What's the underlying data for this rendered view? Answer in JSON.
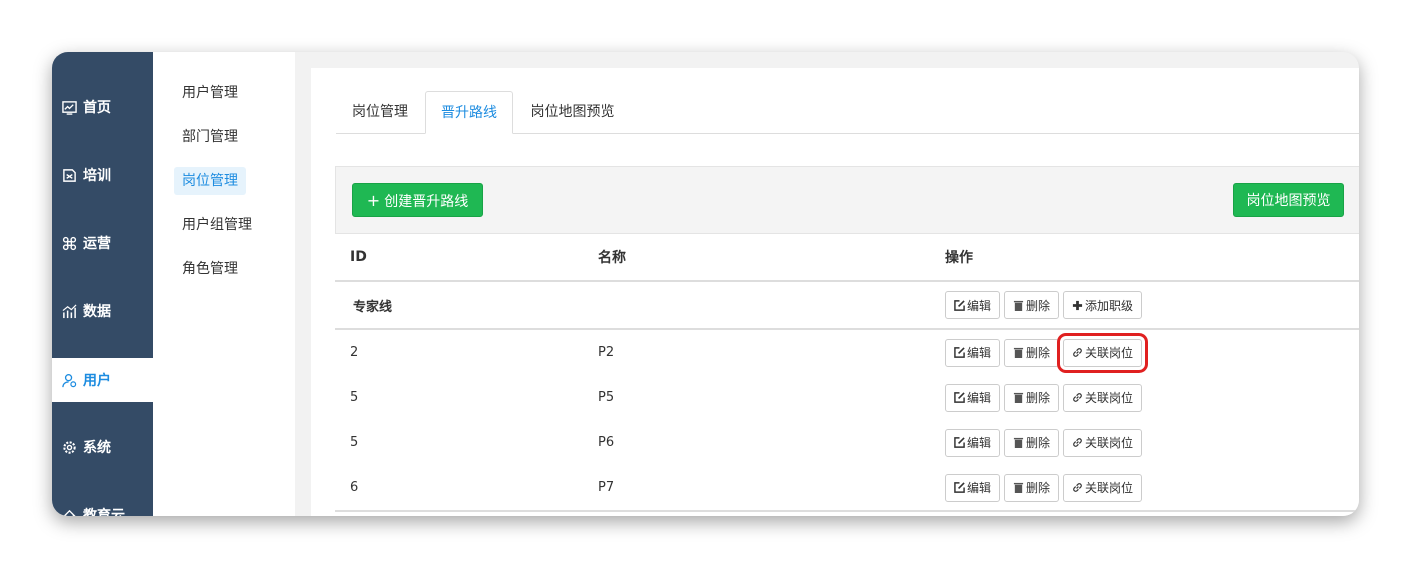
{
  "nav": {
    "items": [
      {
        "label": "首页",
        "icon": "chart-icon"
      },
      {
        "label": "培训",
        "icon": "book-icon"
      },
      {
        "label": "运营",
        "icon": "command-icon"
      },
      {
        "label": "数据",
        "icon": "bar-chart-icon"
      },
      {
        "label": "用户",
        "icon": "user-icon",
        "active": true
      },
      {
        "label": "系统",
        "icon": "gear-icon"
      },
      {
        "label": "教育云",
        "icon": "cloud-icon"
      }
    ]
  },
  "subnav": {
    "items": [
      {
        "label": "用户管理"
      },
      {
        "label": "部门管理"
      },
      {
        "label": "岗位管理",
        "active": true
      },
      {
        "label": "用户组管理"
      },
      {
        "label": "角色管理"
      }
    ]
  },
  "tabs": [
    {
      "label": "岗位管理"
    },
    {
      "label": "晋升路线",
      "active": true
    },
    {
      "label": "岗位地图预览"
    }
  ],
  "toolbar": {
    "create_label": "创建晋升路线",
    "preview_label": "岗位地图预览"
  },
  "table": {
    "headers": {
      "id": "ID",
      "name": "名称",
      "actions": "操作"
    },
    "group": {
      "name": "专家线",
      "edit": "编辑",
      "delete": "删除",
      "add": "添加职级"
    },
    "rows": [
      {
        "id": "2",
        "name": "P2",
        "edit": "编辑",
        "delete": "删除",
        "link": "关联岗位"
      },
      {
        "id": "5",
        "name": "P5",
        "edit": "编辑",
        "delete": "删除",
        "link": "关联岗位"
      },
      {
        "id": "5",
        "name": "P6",
        "edit": "编辑",
        "delete": "删除",
        "link": "关联岗位"
      },
      {
        "id": "6",
        "name": "P7",
        "edit": "编辑",
        "delete": "删除",
        "link": "关联岗位"
      }
    ]
  },
  "colors": {
    "nav_bg": "#344b66",
    "accent": "#1d8ce0",
    "green": "#1fb853",
    "highlight": "#e02020"
  }
}
